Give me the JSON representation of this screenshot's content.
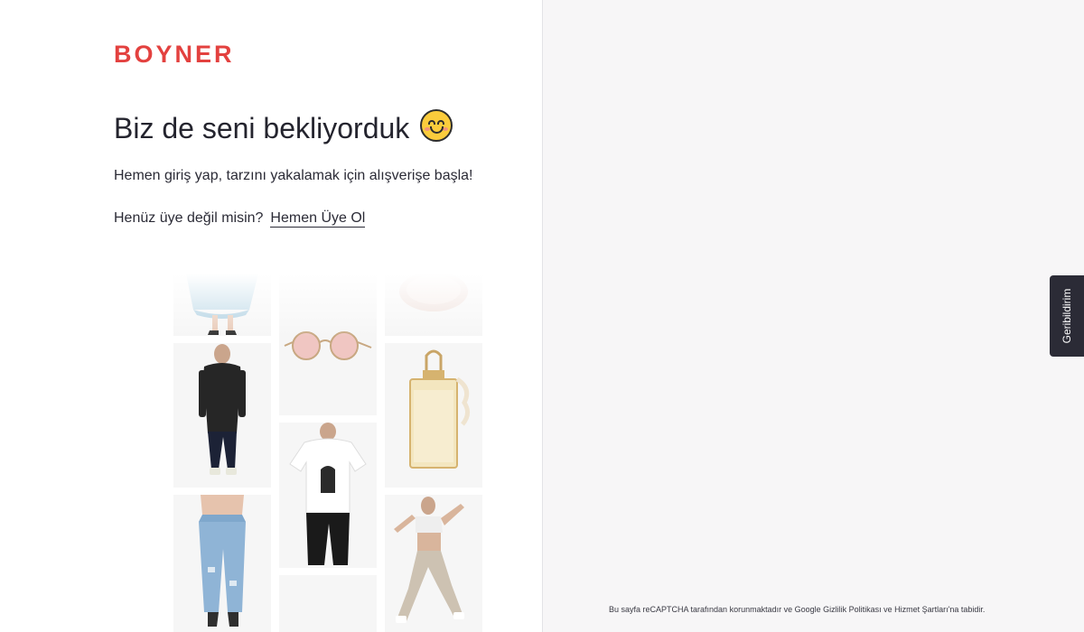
{
  "brand": {
    "logo_text": "BOYNER",
    "accent_color": "#e3413f"
  },
  "login": {
    "title": "Biz de seni bekliyorduk",
    "title_emoji": "smiling-face-icon",
    "subtitle": "Hemen giriş yap, tarzını yakalamak için alışverişe başla!",
    "register_prompt": "Henüz üye değil misin?",
    "register_link": "Hemen Üye Ol"
  },
  "product_gallery": {
    "items": [
      {
        "name": "skirt-product-image"
      },
      {
        "name": "sunglasses-product-image"
      },
      {
        "name": "cosmetic-product-image"
      },
      {
        "name": "mens-outfit-product-image"
      },
      {
        "name": "perfume-product-image"
      },
      {
        "name": "tshirt-product-image"
      },
      {
        "name": "jeans-product-image"
      },
      {
        "name": "sportswear-product-image"
      }
    ]
  },
  "feedback": {
    "label": "Geribildirim"
  },
  "footer": {
    "recaptcha_note": "Bu sayfa reCAPTCHA tarafından korunmaktadır ve Google Gizlilik Politikası ve Hizmet Şartları'na tabidir."
  }
}
